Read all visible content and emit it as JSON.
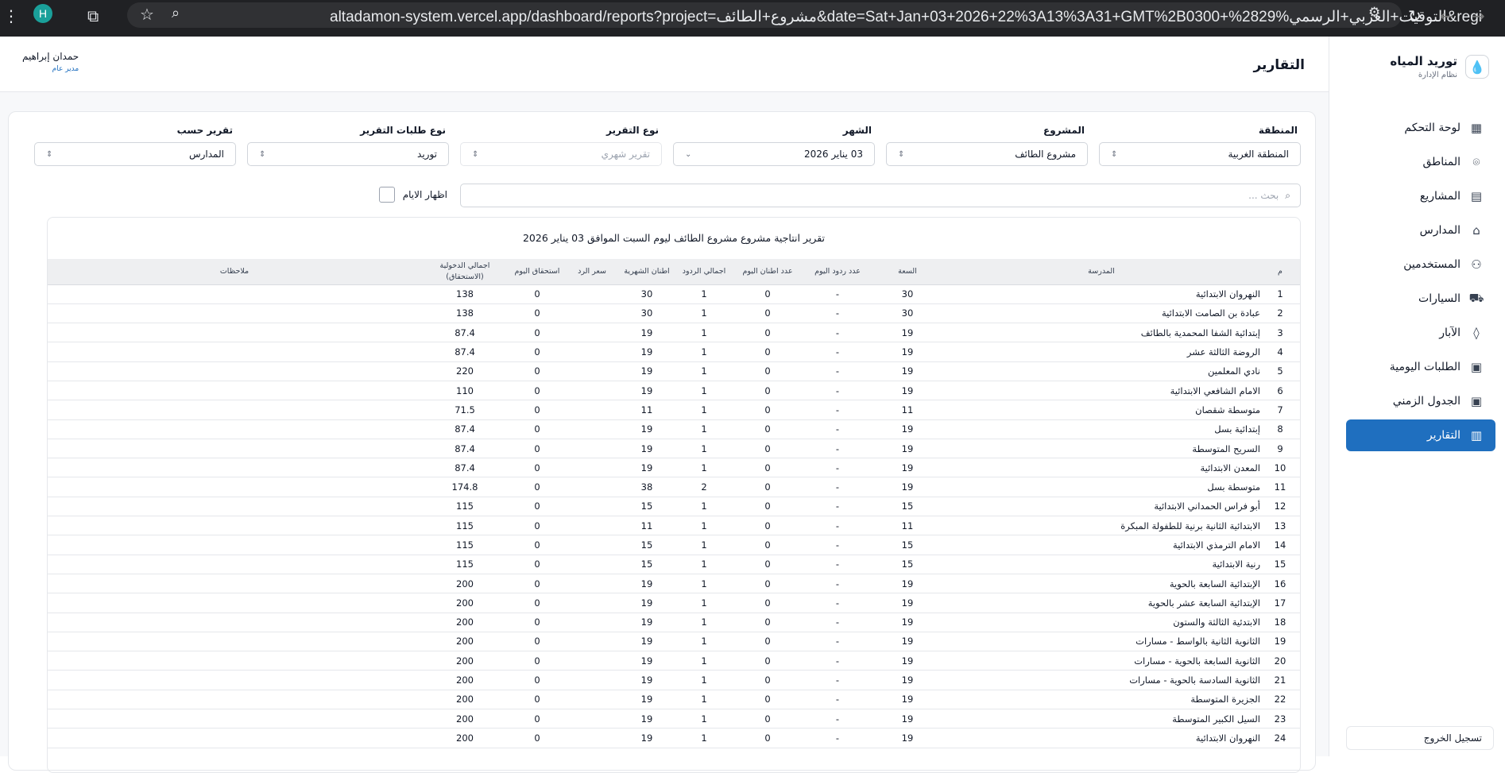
{
  "browser": {
    "profile_initial": "H",
    "url": "altadamon-system.vercel.app/dashboard/reports?project=مشروع+الطائف&date=Sat+Jan+03+2026+22%3A13%3A31+GMT%2B0300+%28التوقيت+العربي+الرسمي%29&region=المنطقة+ا..."
  },
  "sidebar": {
    "title": "توريد المياه",
    "subtitle": "نظام الإدارة",
    "items": [
      {
        "label": "لوحة التحكم",
        "icon": "dashboard-icon"
      },
      {
        "label": "المناطق",
        "icon": "map-pin-icon"
      },
      {
        "label": "المشاريع",
        "icon": "projects-icon"
      },
      {
        "label": "المدارس",
        "icon": "school-icon"
      },
      {
        "label": "المستخدمين",
        "icon": "users-icon"
      },
      {
        "label": "السيارات",
        "icon": "truck-icon"
      },
      {
        "label": "الآبار",
        "icon": "droplet-icon"
      },
      {
        "label": "الطلبات اليومية",
        "icon": "clipboard-icon"
      },
      {
        "label": "الجدول الزمني",
        "icon": "clipboard-icon"
      },
      {
        "label": "التقارير",
        "icon": "chart-icon"
      }
    ],
    "logout": "تسجيل الخروج"
  },
  "header": {
    "title": "التقارير",
    "user_name": "حمدان إبراهيم",
    "user_role": "مدير عام"
  },
  "filters": [
    {
      "label": "المنطقة",
      "value": "المنطقة الغربية",
      "disabled": false
    },
    {
      "label": "المشروع",
      "value": "مشروع الطائف",
      "disabled": false
    },
    {
      "label": "الشهر",
      "value": "03 يناير 2026",
      "disabled": false
    },
    {
      "label": "نوع التقرير",
      "value": "تقرير شهري",
      "disabled": true
    },
    {
      "label": "نوع طلبات التقرير",
      "value": "توريد",
      "disabled": false
    },
    {
      "label": "تقرير حسب",
      "value": "المدارس",
      "disabled": false
    }
  ],
  "search": {
    "placeholder": "بحث ..."
  },
  "show_days_label": "اظهار الايام",
  "report": {
    "title": "تقرير انتاجية مشروع مشروع الطائف ليوم السبت الموافق 03 يناير 2026",
    "columns": [
      "م",
      "المدرسة",
      "السعة",
      "عدد ردود اليوم",
      "عدد اطنان اليوم",
      "اجمالي الردود",
      "اطنان الشهرية",
      "سعر الرد",
      "استحقاق اليوم",
      "اجمالي الدخولية (الاستحقاق)",
      "ملاحظات"
    ],
    "rows": [
      [
        "1",
        "النهروان الابتدائية",
        "30",
        "-",
        "0",
        "1",
        "30",
        "",
        "0",
        "138",
        ""
      ],
      [
        "2",
        "عبادة بن الصامت الابتدائية",
        "30",
        "-",
        "0",
        "1",
        "30",
        "",
        "0",
        "138",
        ""
      ],
      [
        "3",
        "إبتدائية الشفا المحمدية بالطائف",
        "19",
        "-",
        "0",
        "1",
        "19",
        "",
        "0",
        "87.4",
        ""
      ],
      [
        "4",
        "الروضة الثالثة عشر",
        "19",
        "-",
        "0",
        "1",
        "19",
        "",
        "0",
        "87.4",
        ""
      ],
      [
        "5",
        "نادي المعلمين",
        "19",
        "-",
        "0",
        "1",
        "19",
        "",
        "0",
        "220",
        ""
      ],
      [
        "6",
        "الامام الشافعي الابتدائية",
        "19",
        "-",
        "0",
        "1",
        "19",
        "",
        "0",
        "110",
        ""
      ],
      [
        "7",
        "متوسطة شقصان",
        "11",
        "-",
        "0",
        "1",
        "11",
        "",
        "0",
        "71.5",
        ""
      ],
      [
        "8",
        "إبتدائية بسل",
        "19",
        "-",
        "0",
        "1",
        "19",
        "",
        "0",
        "87.4",
        ""
      ],
      [
        "9",
        "السريح المتوسطة",
        "19",
        "-",
        "0",
        "1",
        "19",
        "",
        "0",
        "87.4",
        ""
      ],
      [
        "10",
        "المعدن الابتدائية",
        "19",
        "-",
        "0",
        "1",
        "19",
        "",
        "0",
        "87.4",
        ""
      ],
      [
        "11",
        "متوسطة بسل",
        "19",
        "-",
        "0",
        "2",
        "38",
        "",
        "0",
        "174.8",
        ""
      ],
      [
        "12",
        "أبو فراس الحمداني الابتدائية",
        "15",
        "-",
        "0",
        "1",
        "15",
        "",
        "0",
        "115",
        ""
      ],
      [
        "13",
        "الابتدائية الثانية برنية للطفولة المبكرة",
        "11",
        "-",
        "0",
        "1",
        "11",
        "",
        "0",
        "115",
        ""
      ],
      [
        "14",
        "الامام الترمذي الابتدائية",
        "15",
        "-",
        "0",
        "1",
        "15",
        "",
        "0",
        "115",
        ""
      ],
      [
        "15",
        "رنية الابتدائية",
        "15",
        "-",
        "0",
        "1",
        "15",
        "",
        "0",
        "115",
        ""
      ],
      [
        "16",
        "الإبتدائية السابعة بالحوية",
        "19",
        "-",
        "0",
        "1",
        "19",
        "",
        "0",
        "200",
        ""
      ],
      [
        "17",
        "الإبتدائية السابعة عشر بالحوية",
        "19",
        "-",
        "0",
        "1",
        "19",
        "",
        "0",
        "200",
        ""
      ],
      [
        "18",
        "الابتدئية الثالثة والستون",
        "19",
        "-",
        "0",
        "1",
        "19",
        "",
        "0",
        "200",
        ""
      ],
      [
        "19",
        "الثانوية الثانية بالواسط - مسارات",
        "19",
        "-",
        "0",
        "1",
        "19",
        "",
        "0",
        "200",
        ""
      ],
      [
        "20",
        "الثانوية السابعة بالحوية - مسارات",
        "19",
        "-",
        "0",
        "1",
        "19",
        "",
        "0",
        "200",
        ""
      ],
      [
        "21",
        "الثانوية السادسة بالحوية - مسارات",
        "19",
        "-",
        "0",
        "1",
        "19",
        "",
        "0",
        "200",
        ""
      ],
      [
        "22",
        "الجزيرة المتوسطة",
        "19",
        "-",
        "0",
        "1",
        "19",
        "",
        "0",
        "200",
        ""
      ],
      [
        "23",
        "السيل الكبير المتوسطة",
        "19",
        "-",
        "0",
        "1",
        "19",
        "",
        "0",
        "200",
        ""
      ],
      [
        "24",
        "النهروان الابتدائية",
        "19",
        "-",
        "0",
        "1",
        "19",
        "",
        "0",
        "200",
        ""
      ]
    ]
  }
}
